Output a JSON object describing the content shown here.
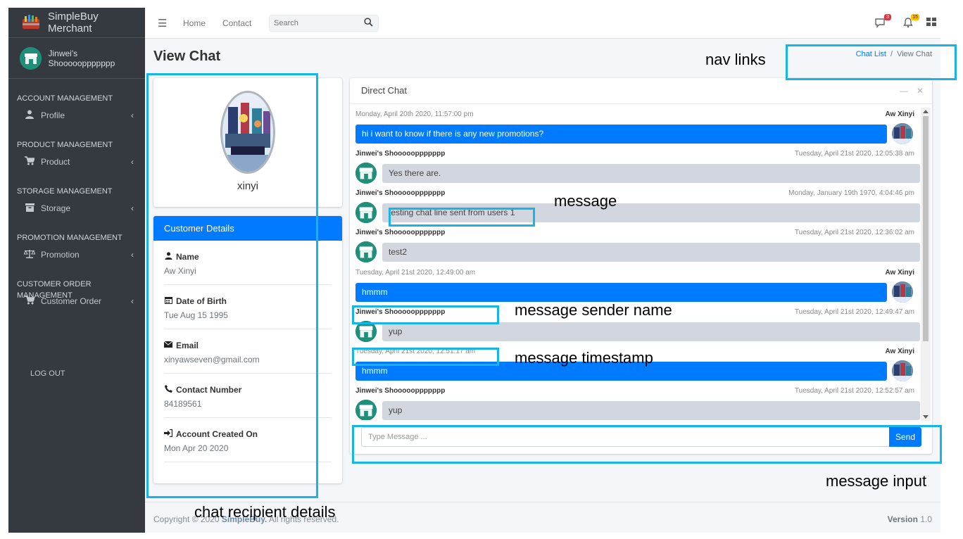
{
  "brand": {
    "name": "SimpleBuy Merchant"
  },
  "user": {
    "name": "Jinwei's Shoooooppppppp"
  },
  "sidebar": {
    "sections": [
      {
        "header": "ACCOUNT MANAGEMENT",
        "item": {
          "label": "Profile",
          "icon": "user-icon"
        }
      },
      {
        "header": "PRODUCT MANAGEMENT",
        "item": {
          "label": "Product",
          "icon": "cart-icon"
        }
      },
      {
        "header": "STORAGE MANAGEMENT",
        "item": {
          "label": "Storage",
          "icon": "archive-icon"
        }
      },
      {
        "header": "PROMOTION MANAGEMENT",
        "item": {
          "label": "Promotion",
          "icon": "balance-scale-icon"
        }
      },
      {
        "header": "CUSTOMER ORDER MANAGEMENT",
        "item": {
          "label": "Customer Order",
          "icon": "cart-icon"
        }
      }
    ],
    "logout": "LOG OUT"
  },
  "topbar": {
    "links": [
      "Home",
      "Contact"
    ],
    "search_placeholder": "Search",
    "messages_badge": "3",
    "notifications_badge": "15"
  },
  "page": {
    "title": "View Chat",
    "breadcrumb": {
      "link": "Chat List",
      "separator": "/",
      "current": "View Chat"
    }
  },
  "profile": {
    "name": "xinyi"
  },
  "details": {
    "header": "Customer Details",
    "items": [
      {
        "label": "Name",
        "value": "Aw Xinyi",
        "icon": "user-icon"
      },
      {
        "label": "Date of Birth",
        "value": "Tue Aug 15 1995",
        "icon": "calendar-icon"
      },
      {
        "label": "Email",
        "value": "xinyawseven@gmail.com",
        "icon": "envelope-icon"
      },
      {
        "label": "Contact Number",
        "value": "84189561",
        "icon": "phone-icon"
      },
      {
        "label": "Account Created On",
        "value": "Mon Apr 20 2020",
        "icon": "sign-in-icon"
      }
    ]
  },
  "chat": {
    "title": "Direct Chat",
    "messages": [
      {
        "side": "right",
        "name": "Aw Xinyi",
        "time": "Monday, April 20th 2020, 11:57:00 pm",
        "text": "hi i want to know if there is any new promotions?"
      },
      {
        "side": "left",
        "name": "Jinwei's Shoooooppppppp",
        "time": "Tuesday, April 21st 2020, 12:05:38 am",
        "text": "Yes there are."
      },
      {
        "side": "left",
        "name": "Jinwei's Shoooooppppppp",
        "time": "Monday, January 19th 1970, 4:04:46 pm",
        "text": "testing chat line sent from users 1"
      },
      {
        "side": "left",
        "name": "Jinwei's Shoooooppppppp",
        "time": "Tuesday, April 21st 2020, 12:36:02 am",
        "text": "test2"
      },
      {
        "side": "right",
        "name": "Aw Xinyi",
        "time": "Tuesday, April 21st 2020, 12:49:00 am",
        "text": "hmmm"
      },
      {
        "side": "left",
        "name": "Jinwei's Shoooooppppppp",
        "time": "Tuesday, April 21st 2020, 12:49:47 am",
        "text": "yup"
      },
      {
        "side": "right",
        "name": "Aw Xinyi",
        "time": "Tuesday, April 21st 2020, 12:51:17 am",
        "text": "hmmm"
      },
      {
        "side": "left",
        "name": "Jinwei's Shoooooppppppp",
        "time": "Tuesday, April 21st 2020, 12:52:57 am",
        "text": "yup"
      }
    ],
    "input_placeholder": "Type Message ...",
    "send_label": "Send"
  },
  "footer": {
    "copyright_prefix": "Copyright © 2020 ",
    "copyright_brand": "SimpleBuy.",
    "copyright_suffix": " All rights reserved.",
    "version_label": "Version",
    "version_value": "1.0"
  },
  "annotations": {
    "nav_links": "nav links",
    "message": "message",
    "sender_name": "message sender name",
    "timestamp": "message timestamp",
    "message_input": "message input",
    "recipient_details": "chat recipient details",
    "color": "#18b4e8"
  }
}
